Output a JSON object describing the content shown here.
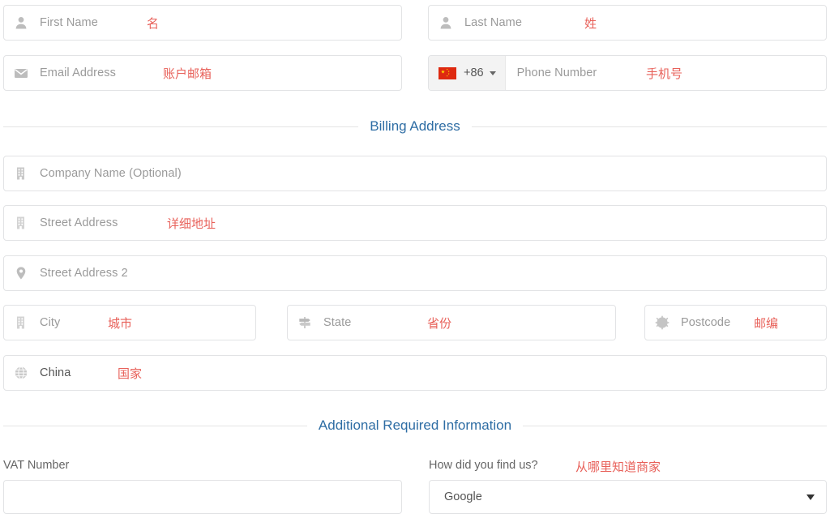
{
  "form": {
    "rows": {
      "first_name": {
        "placeholder": "First Name",
        "note": "名",
        "icon": "user-icon"
      },
      "last_name": {
        "placeholder": "Last Name",
        "note": "姓",
        "icon": "user-icon"
      },
      "email": {
        "placeholder": "Email Address",
        "note": "账户邮箱",
        "icon": "envelope-icon"
      },
      "phone": {
        "country_code": "+86",
        "flag": "china-flag-icon",
        "placeholder": "Phone Number",
        "note": "手机号"
      },
      "company": {
        "placeholder": "Company Name (Optional)",
        "note": "",
        "icon": "building-icon"
      },
      "street": {
        "placeholder": "Street Address",
        "note": "详细地址",
        "icon": "building-icon"
      },
      "street2": {
        "placeholder": "Street Address 2",
        "note": "",
        "icon": "map-pin-icon"
      },
      "city": {
        "placeholder": "City",
        "note": "城市",
        "icon": "building-icon"
      },
      "state": {
        "placeholder": "State",
        "note": "省份",
        "icon": "signpost-icon"
      },
      "postcode": {
        "placeholder": "Postcode",
        "note": "邮编",
        "icon": "sunburst-icon"
      },
      "country": {
        "value": "China",
        "note": "国家",
        "icon": "globe-icon"
      }
    },
    "sections": {
      "billing_address": "Billing Address",
      "additional_info": "Additional Required Information"
    },
    "additional": {
      "vat_label": "VAT Number",
      "vat_value": "",
      "find_us_label": "How did you find us?",
      "find_us_note": "从哪里知道商家",
      "find_us_value": "Google"
    }
  },
  "colors": {
    "section_heading": "#2e6da4",
    "annotation": "#e8615a",
    "border": "#e2e3e5",
    "placeholder": "#9a9a9a",
    "flag_red": "#de2910",
    "flag_yellow": "#ffde00"
  }
}
